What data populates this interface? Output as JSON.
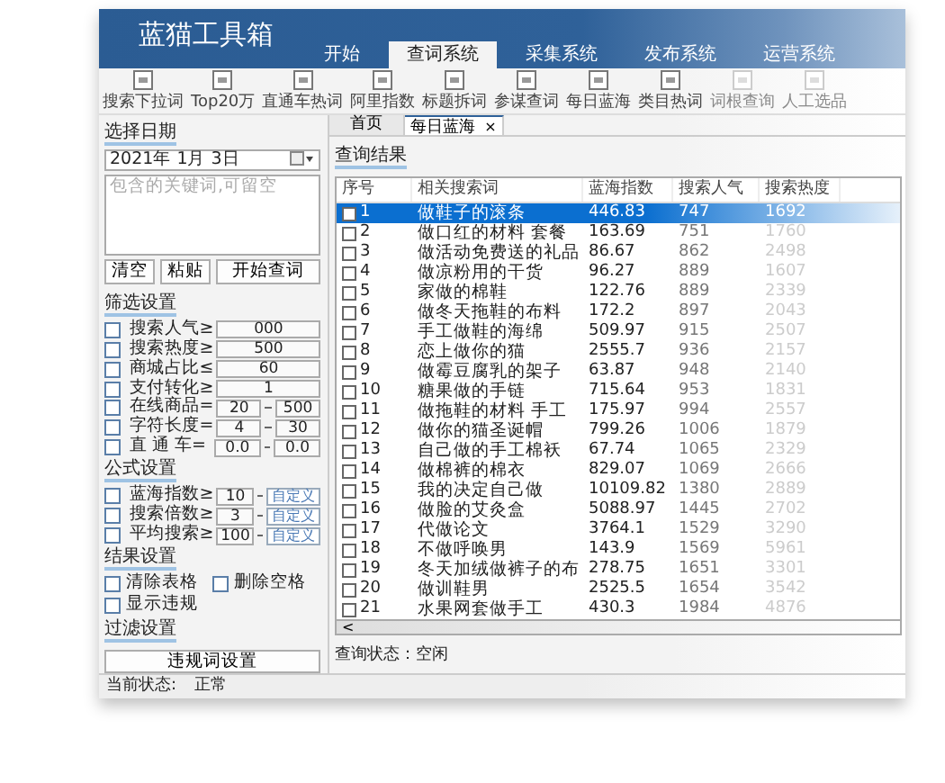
{
  "app": {
    "title": "蓝猫工具箱"
  },
  "menu_tabs": [
    {
      "label": "开始",
      "selected": false
    },
    {
      "label": "查词系统",
      "selected": true
    },
    {
      "label": "采集系统",
      "selected": false
    },
    {
      "label": "发布系统",
      "selected": false
    },
    {
      "label": "运营系统",
      "selected": false
    }
  ],
  "toolbar": [
    {
      "label": "搜索下拉词",
      "dimmed": false
    },
    {
      "label": "Top20万",
      "dimmed": false
    },
    {
      "label": "直通车热词",
      "dimmed": false
    },
    {
      "label": "阿里指数",
      "dimmed": false
    },
    {
      "label": "标题拆词",
      "dimmed": false
    },
    {
      "label": "参谋查词",
      "dimmed": false
    },
    {
      "label": "每日蓝海",
      "dimmed": false
    },
    {
      "label": "类目热词",
      "dimmed": false
    },
    {
      "label": "词根查询",
      "dimmed": true
    },
    {
      "label": "人工选品",
      "dimmed": true
    }
  ],
  "sidebar": {
    "date_heading": "选择日期",
    "date_value": "2021年 1月 3日",
    "keyword_placeholder": "包含的关键词,可留空",
    "buttons": [
      "清空",
      "粘贴",
      "开始查词"
    ],
    "filter_heading": "筛选设置",
    "filters": [
      {
        "kind": "single",
        "label": "搜索人气≥",
        "checked": false,
        "values": [
          "000"
        ]
      },
      {
        "kind": "single",
        "label": "搜索热度≥",
        "checked": false,
        "values": [
          "500"
        ]
      },
      {
        "kind": "single",
        "label": "商城占比≤",
        "checked": false,
        "values": [
          "60"
        ]
      },
      {
        "kind": "single",
        "label": "支付转化≥",
        "checked": false,
        "values": [
          "1"
        ]
      },
      {
        "kind": "range",
        "label": "在线商品=",
        "checked": false,
        "values": [
          "20",
          "500"
        ]
      },
      {
        "kind": "range",
        "label": "字符长度=",
        "checked": false,
        "values": [
          "4",
          "30"
        ]
      },
      {
        "kind": "range",
        "label": "直 通 车=",
        "checked": false,
        "values": [
          "0.0",
          "0.0"
        ]
      }
    ],
    "formula_heading": "公式设置",
    "formulas": [
      {
        "label": "蓝海指数≥",
        "checked": false,
        "value": "10",
        "button": "自定义"
      },
      {
        "label": "搜索倍数≥",
        "checked": false,
        "value": "3",
        "button": "自定义"
      },
      {
        "label": "平均搜索≥",
        "checked": false,
        "value": "100",
        "button": "自定义"
      }
    ],
    "result_heading": "结果设置",
    "result_options": [
      {
        "label": "清除表格",
        "checked": false
      },
      {
        "label": "删除空格",
        "checked": false
      },
      {
        "label": "显示违规",
        "checked": false
      }
    ],
    "filter_settings_heading": "过滤设置",
    "filter_button": "违规词设置"
  },
  "doc_tabs": [
    {
      "label": "首页",
      "selected": false,
      "closable": false
    },
    {
      "label": "每日蓝海",
      "selected": true,
      "closable": true,
      "close": "×"
    }
  ],
  "results": {
    "heading": "查询结果",
    "columns": [
      "序号",
      "相关搜索词",
      "蓝海指数",
      "搜索人气",
      "搜索热度"
    ],
    "rows": [
      {
        "selected": true,
        "checked": false,
        "cells": [
          "1",
          "做鞋子的滚条",
          "446.83",
          "747",
          "1692"
        ]
      },
      {
        "selected": false,
        "checked": false,
        "cells": [
          "2",
          "做口红的材料 套餐",
          "163.69",
          "751",
          "1760"
        ]
      },
      {
        "selected": false,
        "checked": false,
        "cells": [
          "3",
          "做活动免费送的礼品",
          "86.67",
          "862",
          "2498"
        ]
      },
      {
        "selected": false,
        "checked": false,
        "cells": [
          "4",
          "做凉粉用的干货",
          "96.27",
          "889",
          "1607"
        ]
      },
      {
        "selected": false,
        "checked": false,
        "cells": [
          "5",
          "家做的棉鞋",
          "122.76",
          "889",
          "2339"
        ]
      },
      {
        "selected": false,
        "checked": false,
        "cells": [
          "6",
          "做冬天拖鞋的布料",
          "172.2",
          "897",
          "2043"
        ]
      },
      {
        "selected": false,
        "checked": false,
        "cells": [
          "7",
          "手工做鞋的海绵",
          "509.97",
          "915",
          "2507"
        ]
      },
      {
        "selected": false,
        "checked": false,
        "cells": [
          "8",
          "恋上做你的猫",
          "2555.7",
          "936",
          "2157"
        ]
      },
      {
        "selected": false,
        "checked": false,
        "cells": [
          "9",
          "做霉豆腐乳的架子",
          "63.87",
          "948",
          "2140"
        ]
      },
      {
        "selected": false,
        "checked": false,
        "cells": [
          "10",
          "糖果做的手链",
          "715.64",
          "953",
          "1831"
        ]
      },
      {
        "selected": false,
        "checked": false,
        "cells": [
          "11",
          "做拖鞋的材料 手工",
          "175.97",
          "994",
          "2557"
        ]
      },
      {
        "selected": false,
        "checked": false,
        "cells": [
          "12",
          "做你的猫圣诞帽",
          "799.26",
          "1006",
          "1879"
        ]
      },
      {
        "selected": false,
        "checked": false,
        "cells": [
          "13",
          "自己做的手工棉袄",
          "67.74",
          "1065",
          "2329"
        ]
      },
      {
        "selected": false,
        "checked": false,
        "cells": [
          "14",
          "做棉裤的棉衣",
          "829.07",
          "1069",
          "2666"
        ]
      },
      {
        "selected": false,
        "checked": false,
        "cells": [
          "15",
          "我的决定自己做",
          "10109.82",
          "1380",
          "2889"
        ]
      },
      {
        "selected": false,
        "checked": false,
        "cells": [
          "16",
          "做脸的艾灸盒",
          "5088.97",
          "1445",
          "2702"
        ]
      },
      {
        "selected": false,
        "checked": false,
        "cells": [
          "17",
          "代做论文",
          "3764.1",
          "1529",
          "3290"
        ]
      },
      {
        "selected": false,
        "checked": false,
        "cells": [
          "18",
          "不做呼唤男",
          "143.9",
          "1569",
          "5961"
        ]
      },
      {
        "selected": false,
        "checked": false,
        "cells": [
          "19",
          "冬天加绒做裤子的布",
          "278.75",
          "1651",
          "3301"
        ]
      },
      {
        "selected": false,
        "checked": false,
        "cells": [
          "20",
          "做训鞋男",
          "2525.5",
          "1654",
          "3542"
        ]
      },
      {
        "selected": false,
        "checked": false,
        "cells": [
          "21",
          "水果网套做手工",
          "430.3",
          "1984",
          "4876"
        ]
      }
    ],
    "scroll_left": "<",
    "status": "查询状态：空闲"
  },
  "status_bar": {
    "label": "当前状态:",
    "value": "正常"
  }
}
